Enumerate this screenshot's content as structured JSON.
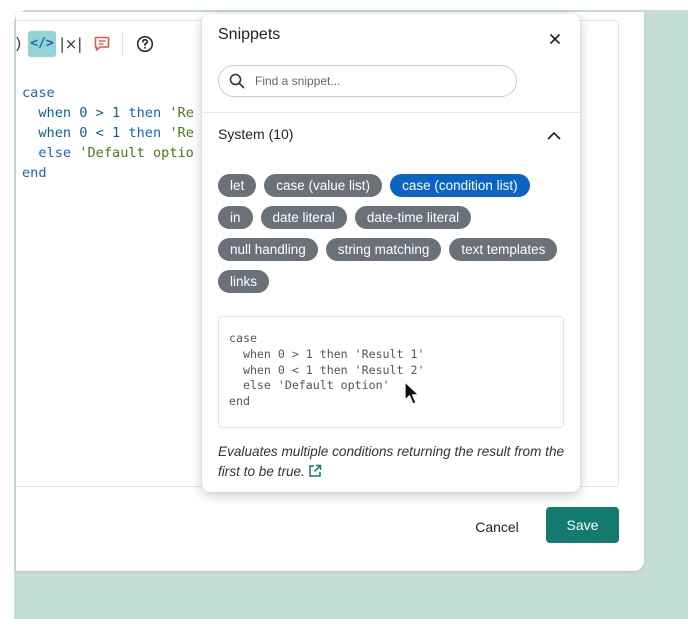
{
  "editor": {
    "toolbar": {
      "paren_glyph": ")",
      "code_glyph": "</>",
      "abs_glyph": "|×|"
    },
    "code_lines": [
      {
        "kw1": "case",
        "rest": ""
      },
      {
        "kw1": "  when 0 > 1 ",
        "kw2": "then",
        "str": " 'Re"
      },
      {
        "kw1": "  when 0 < 1 ",
        "kw2": "then",
        "str": " 'Re"
      },
      {
        "kw1": "  else",
        "kw2": "",
        "str": " 'Default optio"
      },
      {
        "kw1": "end",
        "rest": ""
      }
    ]
  },
  "footer": {
    "cancel_label": "Cancel",
    "save_label": "Save"
  },
  "snippets": {
    "title": "Snippets",
    "search_placeholder": "Find a snippet...",
    "section_title": "System (10)",
    "chips": [
      {
        "label": "let",
        "selected": false
      },
      {
        "label": "case (value list)",
        "selected": false
      },
      {
        "label": "case (condition list)",
        "selected": true
      },
      {
        "label": "in",
        "selected": false
      },
      {
        "label": "date literal",
        "selected": false
      },
      {
        "label": "date-time literal",
        "selected": false
      },
      {
        "label": "null handling",
        "selected": false
      },
      {
        "label": "string matching",
        "selected": false
      },
      {
        "label": "text templates",
        "selected": false
      },
      {
        "label": "links",
        "selected": false
      }
    ],
    "example_code": "case\n  when 0 > 1 then 'Result 1'\n  when 0 < 1 then 'Result 2'\n  else 'Default option'\nend",
    "description": "Evaluates multiple conditions returning the result from the first to be true."
  },
  "colors": {
    "accent_teal": "#137a6f",
    "chip_gray": "#6a7178",
    "chip_selected": "#0b63c4",
    "backdrop": "#c5ded6"
  }
}
